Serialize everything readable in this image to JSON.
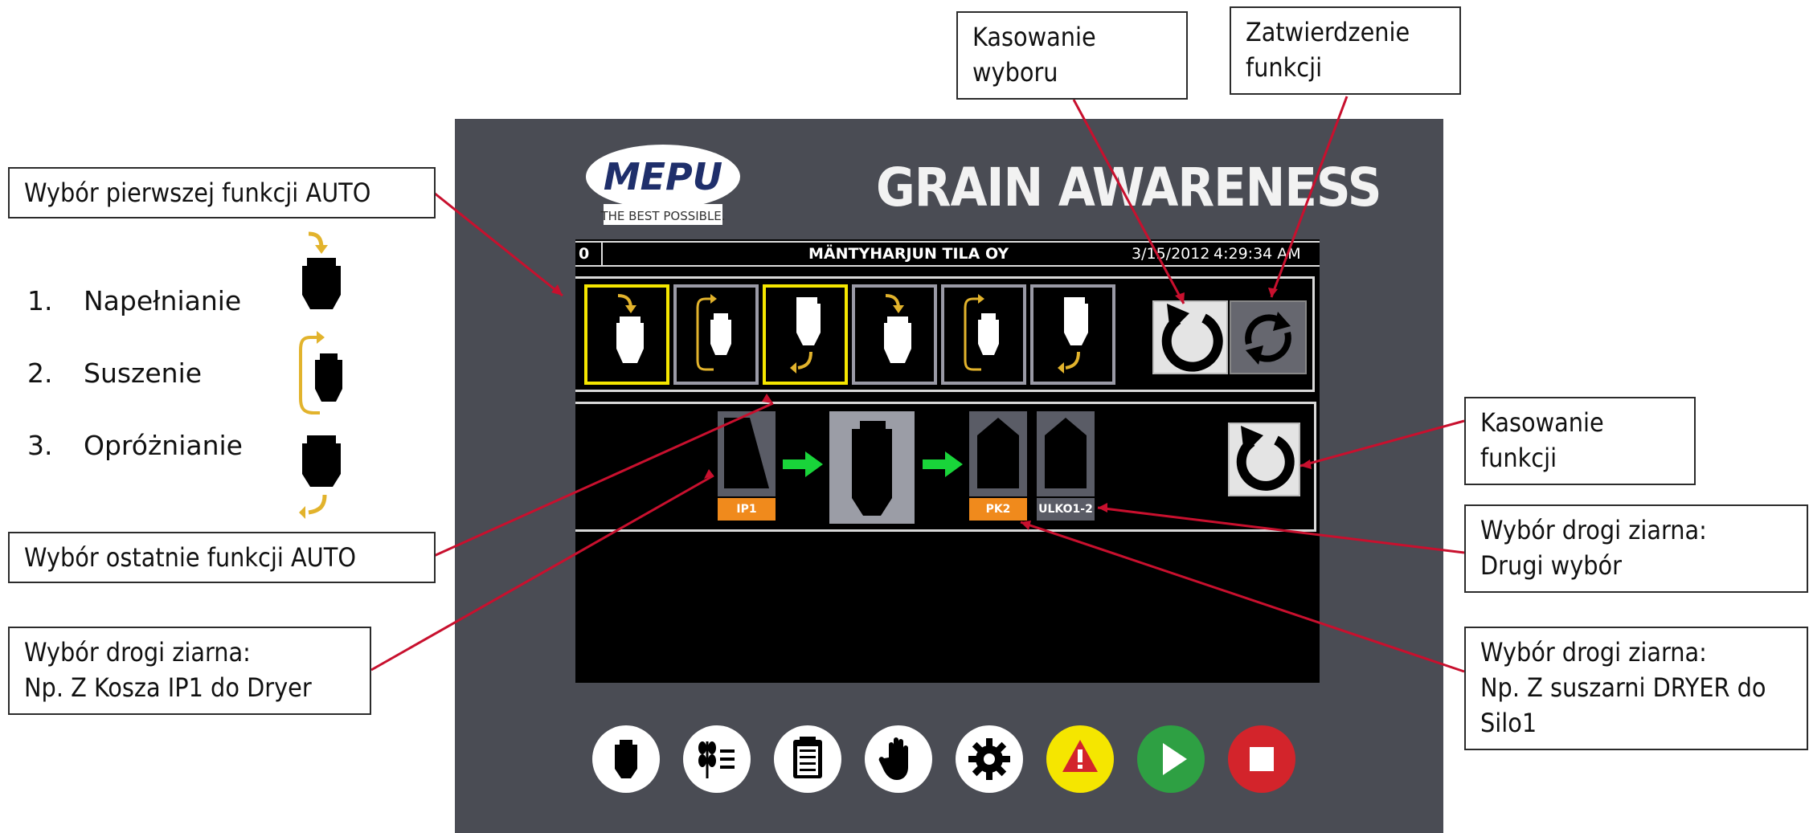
{
  "header": {
    "logo_text": "MEPU",
    "logo_tagline": "THE BEST POSSIBLE.",
    "app_title": "GRAIN AWARENESS"
  },
  "status_bar": {
    "left_value": "0",
    "site_name": "MÄNTYHARJUN TILA OY",
    "date": "3/15/2012",
    "time": "4:29:34 AM"
  },
  "function_buttons": [
    {
      "icon": "filling-icon",
      "selected": true
    },
    {
      "icon": "drying-icon",
      "selected": false
    },
    {
      "icon": "emptying-icon",
      "selected": true
    },
    {
      "icon": "filling-icon",
      "selected": false
    },
    {
      "icon": "drying-icon",
      "selected": false
    },
    {
      "icon": "emptying-icon",
      "selected": false
    }
  ],
  "route": {
    "source_label": "IP1",
    "target_label": "PK2",
    "second_label": "ULKO1-2"
  },
  "toolbar": [
    {
      "icon": "dryer-icon",
      "color": "#ffffff"
    },
    {
      "icon": "grain-list-icon",
      "color": "#ffffff"
    },
    {
      "icon": "clipboard-icon",
      "color": "#ffffff"
    },
    {
      "icon": "hand-stop-icon",
      "color": "#ffffff"
    },
    {
      "icon": "gear-icon",
      "color": "#ffffff"
    },
    {
      "icon": "alarm-icon",
      "color": "#f5e600"
    },
    {
      "icon": "play-icon",
      "color": "#2ea043"
    },
    {
      "icon": "stop-icon",
      "color": "#d3242b"
    }
  ],
  "legend": [
    {
      "num": "1.",
      "label": "Napełnianie"
    },
    {
      "num": "2.",
      "label": "Suszenie"
    },
    {
      "num": "3.",
      "label": "Opróżnianie"
    }
  ],
  "callouts": {
    "first_auto": "Wybór pierwszej funkcji AUTO",
    "last_auto": "Wybór ostatnie funkcji AUTO",
    "route_source_1": "Wybór drogi ziarna:",
    "route_source_2": "Np. Z Kosza IP1 do Dryer",
    "cancel_selection_1": "Kasowanie",
    "cancel_selection_2": "wyboru",
    "confirm_function_1": "Zatwierdzenie",
    "confirm_function_2": "funkcji",
    "cancel_function_1": "Kasowanie",
    "cancel_function_2": "funkcji",
    "second_choice_1": "Wybór drogi ziarna:",
    "second_choice_2": "Drugi wybór",
    "dryer_to_silo_1": "Wybór drogi ziarna:",
    "dryer_to_silo_2": "Np. Z suszarni DRYER do",
    "dryer_to_silo_3": "Silo1"
  },
  "colors": {
    "panel": "#4a4c54",
    "selected_border": "#f5e600",
    "flow_arrow": "#19d43a",
    "route_label": "#f08a1c",
    "leader_line": "#c8102e"
  }
}
